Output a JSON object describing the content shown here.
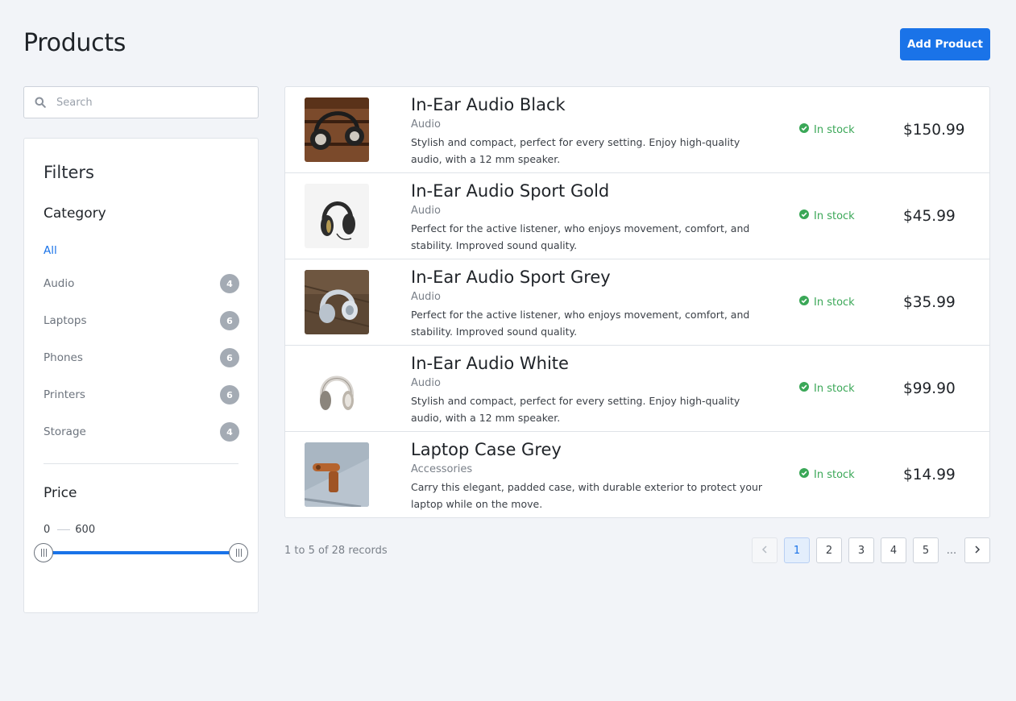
{
  "header": {
    "title": "Products",
    "add_button": "Add Product"
  },
  "search": {
    "placeholder": "Search",
    "value": ""
  },
  "filters": {
    "title": "Filters",
    "category_title": "Category",
    "all_label": "All",
    "categories": [
      {
        "label": "Audio",
        "count": "4"
      },
      {
        "label": "Laptops",
        "count": "6"
      },
      {
        "label": "Phones",
        "count": "6"
      },
      {
        "label": "Printers",
        "count": "6"
      },
      {
        "label": "Storage",
        "count": "4"
      }
    ],
    "price_title": "Price",
    "price_min": "0",
    "price_max": "600"
  },
  "products": [
    {
      "name": "In-Ear Audio Black",
      "category": "Audio",
      "description": "Stylish and compact, perfect for every setting. Enjoy high-quality audio, with a 12 mm speaker.",
      "stock": "In stock",
      "price": "$150.99",
      "image": "headphones-on-wood-dark"
    },
    {
      "name": "In-Ear Audio Sport Gold",
      "category": "Audio",
      "description": "Perfect for the active listener, who enjoys movement, comfort, and stability. Improved sound quality.",
      "stock": "In stock",
      "price": "$45.99",
      "image": "headphones-black-gold"
    },
    {
      "name": "In-Ear Audio Sport Grey",
      "category": "Audio",
      "description": "Perfect for the active listener, who enjoys movement, comfort, and stability. Improved sound quality.",
      "stock": "In stock",
      "price": "$35.99",
      "image": "headphones-grey-on-wood"
    },
    {
      "name": "In-Ear Audio White",
      "category": "Audio",
      "description": "Stylish and compact, perfect for every setting. Enjoy high-quality audio, with a 12 mm speaker.",
      "stock": "In stock",
      "price": "$99.90",
      "image": "headphones-white"
    },
    {
      "name": "Laptop Case Grey",
      "category": "Accessories",
      "description": "Carry this elegant, padded case, with durable exterior to protect your laptop while on the move.",
      "stock": "In stock",
      "price": "$14.99",
      "image": "felt-laptop-case"
    }
  ],
  "pagination": {
    "records": "1 to 5 of 28 records",
    "pages": [
      "1",
      "2",
      "3",
      "4",
      "5"
    ],
    "ellipsis": "...",
    "prev_icon": "chevron-left-icon",
    "next_icon": "chevron-right-icon"
  },
  "colors": {
    "accent": "#1a73e8",
    "stock": "#3aa757",
    "background": "#f2f4f8"
  }
}
